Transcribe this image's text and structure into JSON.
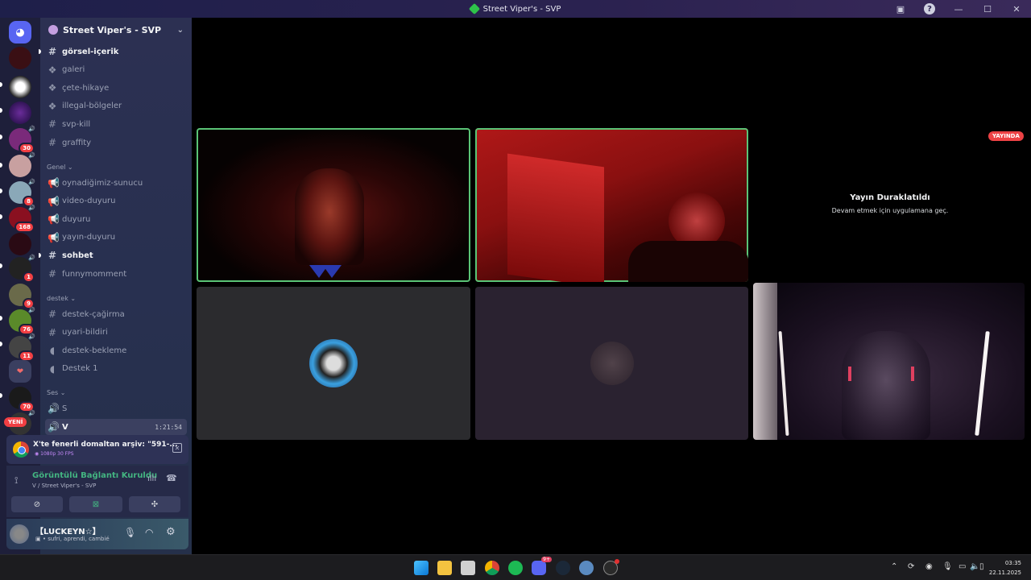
{
  "window": {
    "title": "Street Viper's - SVP"
  },
  "rail": {
    "badges": [
      "30",
      "8",
      "168",
      "1",
      "9",
      "76",
      "11",
      "70"
    ],
    "new_label": "YENİ"
  },
  "sidebar": {
    "server_name": "Street Viper's - SVP",
    "channels_top": [
      {
        "name": "görsel-içerik",
        "icon": "text-channel-icon",
        "unread": true
      },
      {
        "name": "galeri",
        "icon": "forum-icon"
      },
      {
        "name": "çete-hikaye",
        "icon": "forum-icon"
      },
      {
        "name": "illegal-bölgeler",
        "icon": "forum-icon"
      },
      {
        "name": "svp-kill",
        "icon": "text-channel-icon"
      },
      {
        "name": "graffity",
        "icon": "text-channel-icon"
      }
    ],
    "cat_genel": "Genel",
    "channels_genel": [
      {
        "name": "oynadiğimiz-sunucu",
        "icon": "announcement-icon"
      },
      {
        "name": "video-duyuru",
        "icon": "announcement-icon"
      },
      {
        "name": "duyuru",
        "icon": "announcement-icon"
      },
      {
        "name": "yayın-duyuru",
        "icon": "announcement-icon"
      },
      {
        "name": "sohbet",
        "icon": "text-channel-icon",
        "unread": true
      },
      {
        "name": "funnymomment",
        "icon": "text-channel-icon"
      }
    ],
    "cat_destek": "destek",
    "channels_destek": [
      {
        "name": "destek-çağirma",
        "icon": "text-channel-icon"
      },
      {
        "name": "uyari-bildiri",
        "icon": "text-channel-icon"
      },
      {
        "name": "destek-bekleme",
        "icon": "voice-locked-icon"
      },
      {
        "name": "Destek 1",
        "icon": "voice-locked-icon"
      }
    ],
    "cat_ses": "Ses",
    "voice_s": "S",
    "voice_v": "V",
    "voice_v_time": "1:21:54"
  },
  "activity": {
    "stream_title": "X'te fenerli domaltan arşiv: \"591-...",
    "stream_quality": "1080p 30 FPS",
    "connection_status": "Görüntülü Bağlantı Kuruldu",
    "connection_channel": "V / Street Viper's - SVP"
  },
  "user": {
    "name": "【LUCKEYN☆】",
    "status": "sufri, aprendi, cambié"
  },
  "stage": {
    "live_badge": "YAYINDA",
    "paused_title": "Yayın Duraklatıldı",
    "paused_subtitle": "Devam etmek için uygulamana geç."
  },
  "taskbar": {
    "time": "03:35",
    "date": "22.11.2025",
    "discord_badge": "9+"
  }
}
